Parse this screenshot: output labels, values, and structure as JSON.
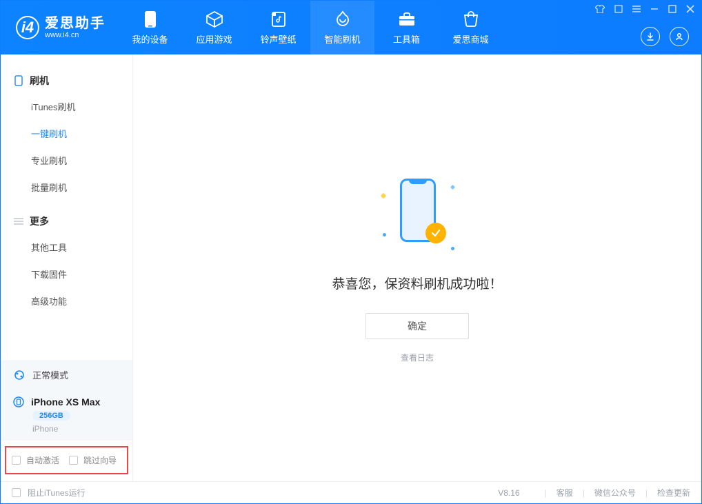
{
  "app": {
    "title": "爱思助手",
    "url": "www.i4.cn"
  },
  "nav": [
    {
      "label": "我的设备",
      "icon": "device"
    },
    {
      "label": "应用游戏",
      "icon": "apps"
    },
    {
      "label": "铃声壁纸",
      "icon": "ringtone"
    },
    {
      "label": "智能刷机",
      "icon": "flash",
      "active": true
    },
    {
      "label": "工具箱",
      "icon": "toolbox"
    },
    {
      "label": "爱思商城",
      "icon": "shop"
    }
  ],
  "sidebar": {
    "section1_title": "刷机",
    "items1": [
      {
        "label": "iTunes刷机"
      },
      {
        "label": "一键刷机",
        "active": true
      },
      {
        "label": "专业刷机"
      },
      {
        "label": "批量刷机"
      }
    ],
    "section2_title": "更多",
    "items2": [
      {
        "label": "其他工具"
      },
      {
        "label": "下载固件"
      },
      {
        "label": "高级功能"
      }
    ],
    "mode_label": "正常模式",
    "device_name": "iPhone XS Max",
    "device_capacity": "256GB",
    "device_type": "iPhone",
    "opt_auto_activate": "自动激活",
    "opt_skip_guide": "跳过向导"
  },
  "main": {
    "success_text": "恭喜您，保资料刷机成功啦！",
    "ok_button": "确定",
    "log_link": "查看日志"
  },
  "footer": {
    "stop_itunes": "阻止iTunes运行",
    "version": "V8.16",
    "links": [
      "客服",
      "微信公众号",
      "检查更新"
    ]
  }
}
